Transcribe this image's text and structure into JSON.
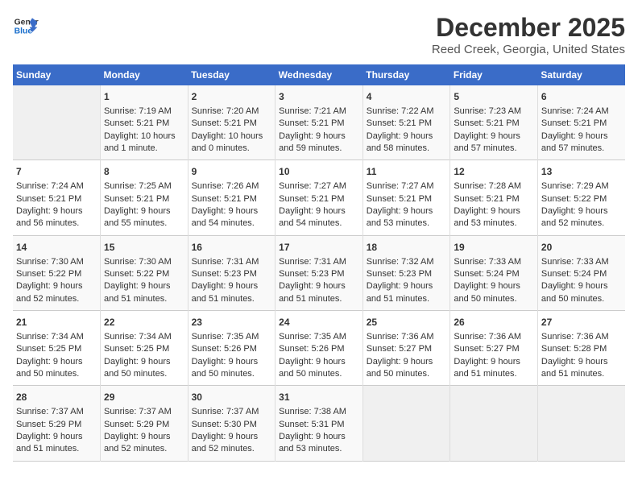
{
  "logo": {
    "line1": "General",
    "line2": "Blue"
  },
  "title": "December 2025",
  "subtitle": "Reed Creek, Georgia, United States",
  "days_of_week": [
    "Sunday",
    "Monday",
    "Tuesday",
    "Wednesday",
    "Thursday",
    "Friday",
    "Saturday"
  ],
  "weeks": [
    [
      {
        "day": "",
        "sunrise": "",
        "sunset": "",
        "daylight": "",
        "empty": true
      },
      {
        "day": "1",
        "sunrise": "Sunrise: 7:19 AM",
        "sunset": "Sunset: 5:21 PM",
        "daylight": "Daylight: 10 hours and 1 minute."
      },
      {
        "day": "2",
        "sunrise": "Sunrise: 7:20 AM",
        "sunset": "Sunset: 5:21 PM",
        "daylight": "Daylight: 10 hours and 0 minutes."
      },
      {
        "day": "3",
        "sunrise": "Sunrise: 7:21 AM",
        "sunset": "Sunset: 5:21 PM",
        "daylight": "Daylight: 9 hours and 59 minutes."
      },
      {
        "day": "4",
        "sunrise": "Sunrise: 7:22 AM",
        "sunset": "Sunset: 5:21 PM",
        "daylight": "Daylight: 9 hours and 58 minutes."
      },
      {
        "day": "5",
        "sunrise": "Sunrise: 7:23 AM",
        "sunset": "Sunset: 5:21 PM",
        "daylight": "Daylight: 9 hours and 57 minutes."
      },
      {
        "day": "6",
        "sunrise": "Sunrise: 7:24 AM",
        "sunset": "Sunset: 5:21 PM",
        "daylight": "Daylight: 9 hours and 57 minutes."
      }
    ],
    [
      {
        "day": "7",
        "sunrise": "Sunrise: 7:24 AM",
        "sunset": "Sunset: 5:21 PM",
        "daylight": "Daylight: 9 hours and 56 minutes."
      },
      {
        "day": "8",
        "sunrise": "Sunrise: 7:25 AM",
        "sunset": "Sunset: 5:21 PM",
        "daylight": "Daylight: 9 hours and 55 minutes."
      },
      {
        "day": "9",
        "sunrise": "Sunrise: 7:26 AM",
        "sunset": "Sunset: 5:21 PM",
        "daylight": "Daylight: 9 hours and 54 minutes."
      },
      {
        "day": "10",
        "sunrise": "Sunrise: 7:27 AM",
        "sunset": "Sunset: 5:21 PM",
        "daylight": "Daylight: 9 hours and 54 minutes."
      },
      {
        "day": "11",
        "sunrise": "Sunrise: 7:27 AM",
        "sunset": "Sunset: 5:21 PM",
        "daylight": "Daylight: 9 hours and 53 minutes."
      },
      {
        "day": "12",
        "sunrise": "Sunrise: 7:28 AM",
        "sunset": "Sunset: 5:21 PM",
        "daylight": "Daylight: 9 hours and 53 minutes."
      },
      {
        "day": "13",
        "sunrise": "Sunrise: 7:29 AM",
        "sunset": "Sunset: 5:22 PM",
        "daylight": "Daylight: 9 hours and 52 minutes."
      }
    ],
    [
      {
        "day": "14",
        "sunrise": "Sunrise: 7:30 AM",
        "sunset": "Sunset: 5:22 PM",
        "daylight": "Daylight: 9 hours and 52 minutes."
      },
      {
        "day": "15",
        "sunrise": "Sunrise: 7:30 AM",
        "sunset": "Sunset: 5:22 PM",
        "daylight": "Daylight: 9 hours and 51 minutes."
      },
      {
        "day": "16",
        "sunrise": "Sunrise: 7:31 AM",
        "sunset": "Sunset: 5:23 PM",
        "daylight": "Daylight: 9 hours and 51 minutes."
      },
      {
        "day": "17",
        "sunrise": "Sunrise: 7:31 AM",
        "sunset": "Sunset: 5:23 PM",
        "daylight": "Daylight: 9 hours and 51 minutes."
      },
      {
        "day": "18",
        "sunrise": "Sunrise: 7:32 AM",
        "sunset": "Sunset: 5:23 PM",
        "daylight": "Daylight: 9 hours and 51 minutes."
      },
      {
        "day": "19",
        "sunrise": "Sunrise: 7:33 AM",
        "sunset": "Sunset: 5:24 PM",
        "daylight": "Daylight: 9 hours and 50 minutes."
      },
      {
        "day": "20",
        "sunrise": "Sunrise: 7:33 AM",
        "sunset": "Sunset: 5:24 PM",
        "daylight": "Daylight: 9 hours and 50 minutes."
      }
    ],
    [
      {
        "day": "21",
        "sunrise": "Sunrise: 7:34 AM",
        "sunset": "Sunset: 5:25 PM",
        "daylight": "Daylight: 9 hours and 50 minutes."
      },
      {
        "day": "22",
        "sunrise": "Sunrise: 7:34 AM",
        "sunset": "Sunset: 5:25 PM",
        "daylight": "Daylight: 9 hours and 50 minutes."
      },
      {
        "day": "23",
        "sunrise": "Sunrise: 7:35 AM",
        "sunset": "Sunset: 5:26 PM",
        "daylight": "Daylight: 9 hours and 50 minutes."
      },
      {
        "day": "24",
        "sunrise": "Sunrise: 7:35 AM",
        "sunset": "Sunset: 5:26 PM",
        "daylight": "Daylight: 9 hours and 50 minutes."
      },
      {
        "day": "25",
        "sunrise": "Sunrise: 7:36 AM",
        "sunset": "Sunset: 5:27 PM",
        "daylight": "Daylight: 9 hours and 50 minutes."
      },
      {
        "day": "26",
        "sunrise": "Sunrise: 7:36 AM",
        "sunset": "Sunset: 5:27 PM",
        "daylight": "Daylight: 9 hours and 51 minutes."
      },
      {
        "day": "27",
        "sunrise": "Sunrise: 7:36 AM",
        "sunset": "Sunset: 5:28 PM",
        "daylight": "Daylight: 9 hours and 51 minutes."
      }
    ],
    [
      {
        "day": "28",
        "sunrise": "Sunrise: 7:37 AM",
        "sunset": "Sunset: 5:29 PM",
        "daylight": "Daylight: 9 hours and 51 minutes."
      },
      {
        "day": "29",
        "sunrise": "Sunrise: 7:37 AM",
        "sunset": "Sunset: 5:29 PM",
        "daylight": "Daylight: 9 hours and 52 minutes."
      },
      {
        "day": "30",
        "sunrise": "Sunrise: 7:37 AM",
        "sunset": "Sunset: 5:30 PM",
        "daylight": "Daylight: 9 hours and 52 minutes."
      },
      {
        "day": "31",
        "sunrise": "Sunrise: 7:38 AM",
        "sunset": "Sunset: 5:31 PM",
        "daylight": "Daylight: 9 hours and 53 minutes."
      },
      {
        "day": "",
        "sunrise": "",
        "sunset": "",
        "daylight": "",
        "empty": true
      },
      {
        "day": "",
        "sunrise": "",
        "sunset": "",
        "daylight": "",
        "empty": true
      },
      {
        "day": "",
        "sunrise": "",
        "sunset": "",
        "daylight": "",
        "empty": true
      }
    ]
  ]
}
